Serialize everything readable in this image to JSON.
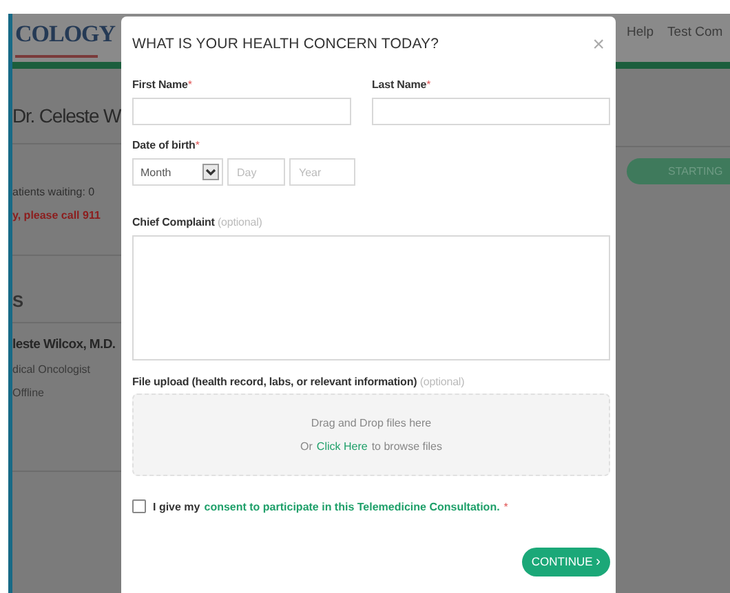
{
  "background": {
    "logo": "COLOGY",
    "nav": [
      "Help",
      "Test Com"
    ],
    "doctor_heading": "Dr. Celeste W",
    "patients_waiting": "atients waiting: 0",
    "emergency_note": "y, please call 911",
    "section_heading": "S",
    "doctor": {
      "name": "leste Wilcox, M.D.",
      "title": "dical Oncologist",
      "status": "Offline"
    },
    "start_button": "STARTING"
  },
  "modal": {
    "title": "WHAT IS YOUR HEALTH CONCERN TODAY?",
    "close": "×",
    "required_mark": "*",
    "first_name": {
      "label": "First Name",
      "required": true
    },
    "last_name": {
      "label": "Last Name",
      "required": true
    },
    "date_of_birth": {
      "label": "Date of birth",
      "required": true,
      "month": "Month",
      "day_placeholder": "Day",
      "year_placeholder": "Year"
    },
    "chief_complaint": {
      "label": "Chief Complaint",
      "hint": "(optional)"
    },
    "file_upload": {
      "label": "File upload (health record, labs, or relevant information)",
      "hint": "(optional)",
      "drop_text": "Drag and Drop files here",
      "browse_prefix": "Or",
      "browse_link": "Click Here",
      "browse_suffix": "to browse files"
    },
    "consent": {
      "checked": false,
      "prefix": "I give my",
      "link": "consent to participate in this Telemedicine Consultation.",
      "required": true
    },
    "continue_button": {
      "label": "CONTINUE",
      "icon": "›"
    }
  }
}
